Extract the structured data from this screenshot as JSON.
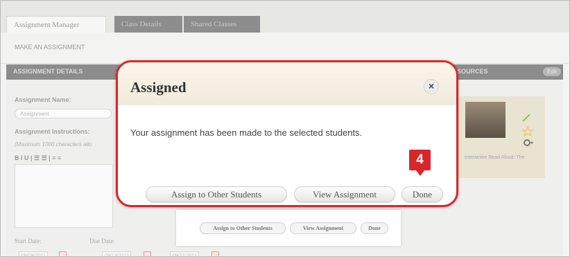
{
  "tabs": [
    {
      "label": "Assignment Manager"
    },
    {
      "label": "Class Details"
    },
    {
      "label": "Shared Classes"
    }
  ],
  "subheader": "MAKE AN ASSIGNMENT",
  "sections": {
    "details": "ASSIGNMENT DETAILS",
    "resources": "SOURCES",
    "edit": "Edit"
  },
  "form": {
    "name_label": "Assignment Name:",
    "name_value": "Assignment",
    "instructions_label": "Assignment Instructions:",
    "instructions_hint": "(Maximum 1000 characters allo",
    "toolbar": "B  I  U  |  ☰  ☰  |  ≡  ≡",
    "start_label": "Start Date:",
    "due_label": "Due Date:",
    "dates": [
      "09/09/2021",
      "09/13/2021",
      "09/22/2021"
    ]
  },
  "resource": {
    "label": "Interactive Read Aloud: The"
  },
  "background_dialog": {
    "buttons": [
      "Assign to Other Students",
      "View Assignment",
      "Done"
    ]
  },
  "modal": {
    "title": "Assigned",
    "close": "×",
    "message": "Your assignment has been made to the selected students.",
    "assign_other": "Assign to Other Students",
    "view_assignment": "View Assignment",
    "done": "Done"
  },
  "callout": {
    "step": "4"
  },
  "colors": {
    "accent_red": "#d9262b",
    "header_gray": "#8c8c8c",
    "modal_head": "#f3eee2"
  }
}
